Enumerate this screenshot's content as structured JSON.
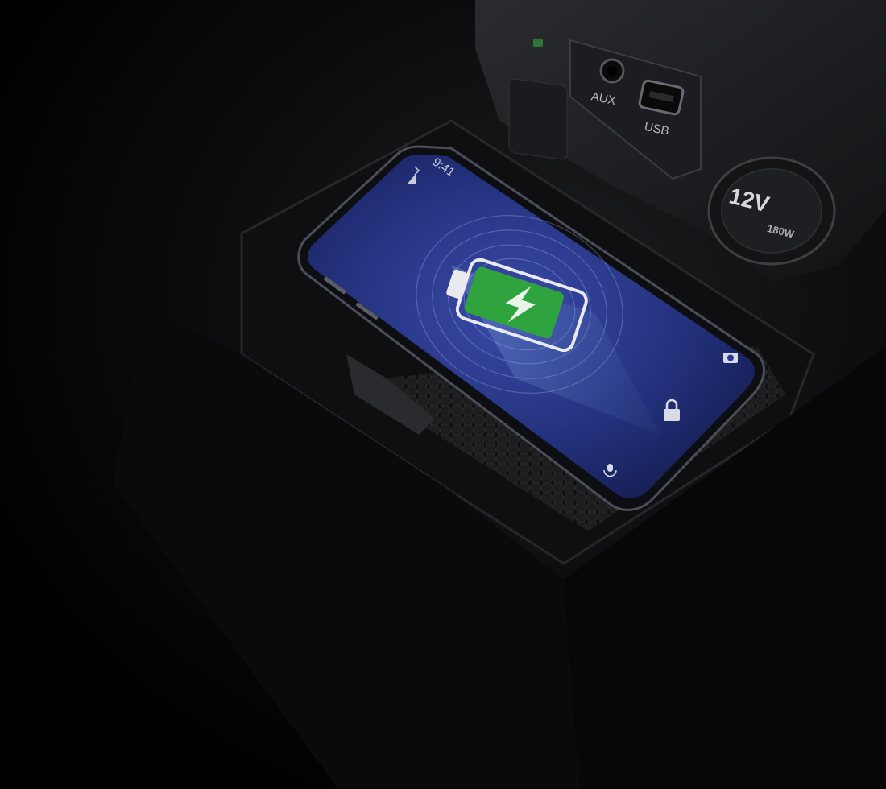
{
  "scene": {
    "port_labels": {
      "aux": "AUX",
      "usb": "USB"
    },
    "power_outlet": {
      "voltage": "12V",
      "wattage": "180W"
    }
  },
  "phone": {
    "status_time": "9:41",
    "battery_level": 0.85,
    "icons": [
      "bluetooth-icon",
      "signal-icon",
      "battery-icon",
      "charging-bolt-icon",
      "camera-icon",
      "lock-icon",
      "microphone-icon"
    ]
  },
  "colors": {
    "battery_green": "#2fa33d",
    "screen_blue": "#2b3a8e"
  }
}
